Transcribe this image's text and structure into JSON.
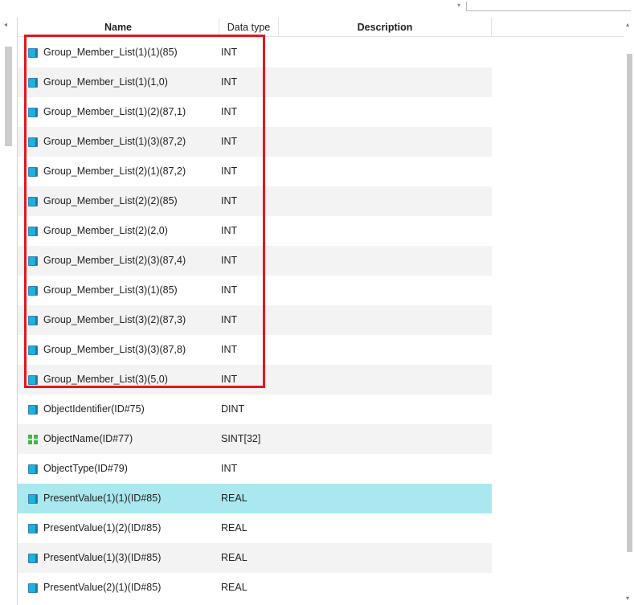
{
  "header": {
    "name": "Name",
    "data_type": "Data type",
    "description": "Description"
  },
  "rows": [
    {
      "name": "Group_Member_List(1)(1)(85)",
      "type": "INT",
      "icon": "blue-square-icon"
    },
    {
      "name": "Group_Member_List(1)(1,0)",
      "type": "INT",
      "icon": "blue-square-icon"
    },
    {
      "name": "Group_Member_List(1)(2)(87,1)",
      "type": "INT",
      "icon": "blue-square-icon"
    },
    {
      "name": "Group_Member_List(1)(3)(87,2)",
      "type": "INT",
      "icon": "blue-square-icon"
    },
    {
      "name": "Group_Member_List(2)(1)(87,2)",
      "type": "INT",
      "icon": "blue-square-icon"
    },
    {
      "name": "Group_Member_List(2)(2)(85)",
      "type": "INT",
      "icon": "blue-square-icon"
    },
    {
      "name": "Group_Member_List(2)(2,0)",
      "type": "INT",
      "icon": "blue-square-icon"
    },
    {
      "name": "Group_Member_List(2)(3)(87,4)",
      "type": "INT",
      "icon": "blue-square-icon"
    },
    {
      "name": "Group_Member_List(3)(1)(85)",
      "type": "INT",
      "icon": "blue-square-icon"
    },
    {
      "name": "Group_Member_List(3)(2)(87,3)",
      "type": "INT",
      "icon": "blue-square-icon"
    },
    {
      "name": "Group_Member_List(3)(3)(87,8)",
      "type": "INT",
      "icon": "blue-square-icon"
    },
    {
      "name": "Group_Member_List(3)(5,0)",
      "type": "INT",
      "icon": "blue-square-icon"
    },
    {
      "name": "ObjectIdentifier(ID#75)",
      "type": "DINT",
      "icon": "blue-square-icon"
    },
    {
      "name": "ObjectName(ID#77)",
      "type": "SINT[32]",
      "icon": "green-grid-icon"
    },
    {
      "name": "ObjectType(ID#79)",
      "type": "INT",
      "icon": "blue-square-icon"
    },
    {
      "name": "PresentValue(1)(1)(ID#85)",
      "type": "REAL",
      "icon": "blue-square-icon",
      "selected": true
    },
    {
      "name": "PresentValue(1)(2)(ID#85)",
      "type": "REAL",
      "icon": "blue-square-icon"
    },
    {
      "name": "PresentValue(1)(3)(ID#85)",
      "type": "REAL",
      "icon": "blue-square-icon"
    },
    {
      "name": "PresentValue(2)(1)(ID#85)",
      "type": "REAL",
      "icon": "blue-square-icon"
    }
  ],
  "colors": {
    "highlight_box": "#e3161d",
    "selected_row": "#a9e8ee",
    "alt_row": "#f3f3f3"
  }
}
